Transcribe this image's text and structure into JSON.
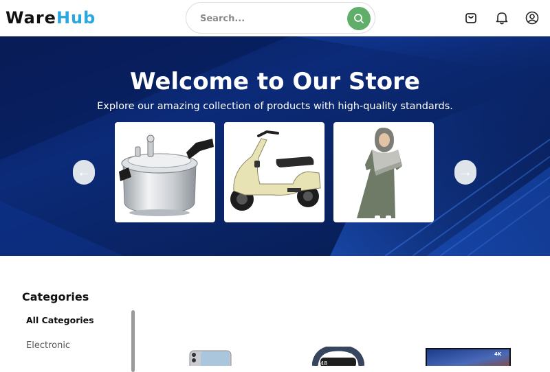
{
  "header": {
    "logo_part1": "Ware",
    "logo_part2": "Hub",
    "search_placeholder": "Search...",
    "icons": [
      "search-icon",
      "shopping-bag-icon",
      "bell-icon",
      "user-account-icon"
    ]
  },
  "hero": {
    "title": "Welcome to Our Store",
    "subtitle": "Explore our amazing collection of products with high-quality standards.",
    "products": [
      {
        "name": "pressure-cooker"
      },
      {
        "name": "electric-scooter"
      },
      {
        "name": "abaya-dress"
      }
    ],
    "prev_label": "←",
    "next_label": "→"
  },
  "categories": {
    "title": "Categories",
    "items": [
      {
        "label": "All Categories",
        "active": true
      },
      {
        "label": "Electronic",
        "active": false
      }
    ]
  },
  "colors": {
    "accent_green": "#5fae6a",
    "logo_blue": "#2aa6e0",
    "hero_blue": "#0b2a78"
  }
}
